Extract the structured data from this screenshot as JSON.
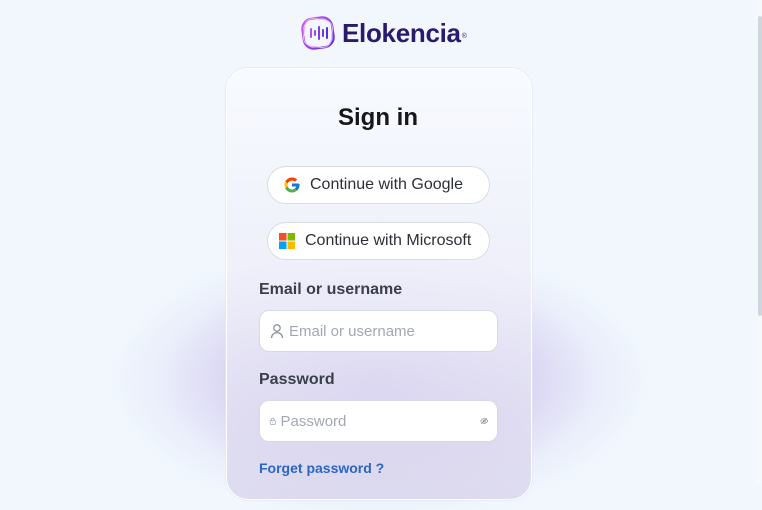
{
  "brand": {
    "name": "Elokencia",
    "trademark": "®",
    "accent": "#7b3fe4",
    "text_color": "#2a1a6b"
  },
  "signin": {
    "title": "Sign in",
    "google_label": "Continue with Google",
    "microsoft_label": "Continue with Microsoft",
    "email_label": "Email or username",
    "email_placeholder": "Email or username",
    "email_value": "",
    "password_label": "Password",
    "password_placeholder": "Password",
    "password_value": "",
    "forgot_label": "Forget password ?"
  },
  "icons": {
    "google": "google-icon",
    "microsoft": "microsoft-icon",
    "user": "user-icon",
    "lock": "lock-icon",
    "toggle_password": "eye-off-icon"
  },
  "colors": {
    "link": "#2b66c2",
    "background": "#f1f7fd",
    "glow": "#966edc"
  }
}
